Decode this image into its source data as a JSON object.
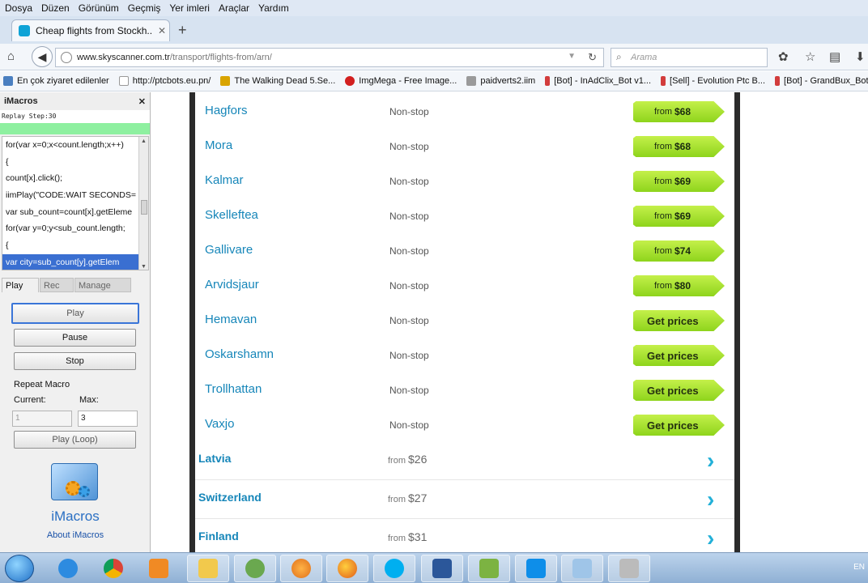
{
  "menu": [
    "Dosya",
    "Düzen",
    "Görünüm",
    "Geçmiş",
    "Yer imleri",
    "Araçlar",
    "Yardım"
  ],
  "tab": {
    "title": "Cheap flights from Stockh..."
  },
  "url": {
    "host": "www.skyscanner.com.tr",
    "path": "/transport/flights-from/arn/"
  },
  "search": {
    "placeholder": "Arama"
  },
  "bookmarks": [
    {
      "label": "En çok ziyaret edilenler",
      "color": "#4a7fc0"
    },
    {
      "label": "http://ptcbots.eu.pn/",
      "color": "#ffffff"
    },
    {
      "label": "The Walking Dead 5.Se...",
      "color": "#d9a400"
    },
    {
      "label": "ImgMega - Free Image...",
      "color": "#d21f1f"
    },
    {
      "label": "paidverts2.iim",
      "color": "#9a9a9a"
    },
    {
      "label": "[Bot] - InAdClix_Bot v1...",
      "color": "#d23c3c"
    },
    {
      "label": "[Sell] - Evolution Ptc B...",
      "color": "#d23c3c"
    },
    {
      "label": "[Bot] - GrandBux_Bot",
      "color": "#d23c3c"
    }
  ],
  "imacros": {
    "title": "iMacros",
    "status": "Replay Step:30",
    "code_lines": [
      "for(var x=0;x<count.length;x++)",
      "{",
      "count[x].click();",
      "iimPlay(\"CODE:WAIT SECONDS=",
      "var sub_count=count[x].getEleme",
      "for(var y=0;y<sub_count.length;",
      "{",
      "var city=sub_count[y].getElem"
    ],
    "tabs": {
      "play": "Play",
      "rec": "Rec",
      "manage": "Manage"
    },
    "buttons": {
      "play": "Play",
      "pause": "Pause",
      "stop": "Stop",
      "loop": "Play (Loop)"
    },
    "repeat_label": "Repeat Macro",
    "current_label": "Current:",
    "max_label": "Max:",
    "current_value": "1",
    "max_value": "3",
    "logo_text": "iMacros",
    "about": "About iMacros"
  },
  "cities": [
    {
      "name": "Hagfors",
      "stops": "Non-stop",
      "from": "from",
      "price": "$68"
    },
    {
      "name": "Mora",
      "stops": "Non-stop",
      "from": "from",
      "price": "$68"
    },
    {
      "name": "Kalmar",
      "stops": "Non-stop",
      "from": "from",
      "price": "$69"
    },
    {
      "name": "Skelleftea",
      "stops": "Non-stop",
      "from": "from",
      "price": "$69"
    },
    {
      "name": "Gallivare",
      "stops": "Non-stop",
      "from": "from",
      "price": "$74"
    },
    {
      "name": "Arvidsjaur",
      "stops": "Non-stop",
      "from": "from",
      "price": "$80"
    },
    {
      "name": "Hemavan",
      "stops": "Non-stop",
      "get": "Get prices"
    },
    {
      "name": "Oskarshamn",
      "stops": "Non-stop",
      "get": "Get prices"
    },
    {
      "name": "Trollhattan",
      "stops": "Non-stop",
      "get": "Get prices"
    },
    {
      "name": "Vaxjo",
      "stops": "Non-stop",
      "get": "Get prices"
    }
  ],
  "countries": [
    {
      "name": "Latvia",
      "from": "from",
      "price": "$26"
    },
    {
      "name": "Switzerland",
      "from": "from",
      "price": "$27"
    },
    {
      "name": "Finland",
      "from": "from",
      "price": "$31"
    }
  ],
  "taskbar": {
    "lang": "EN"
  }
}
